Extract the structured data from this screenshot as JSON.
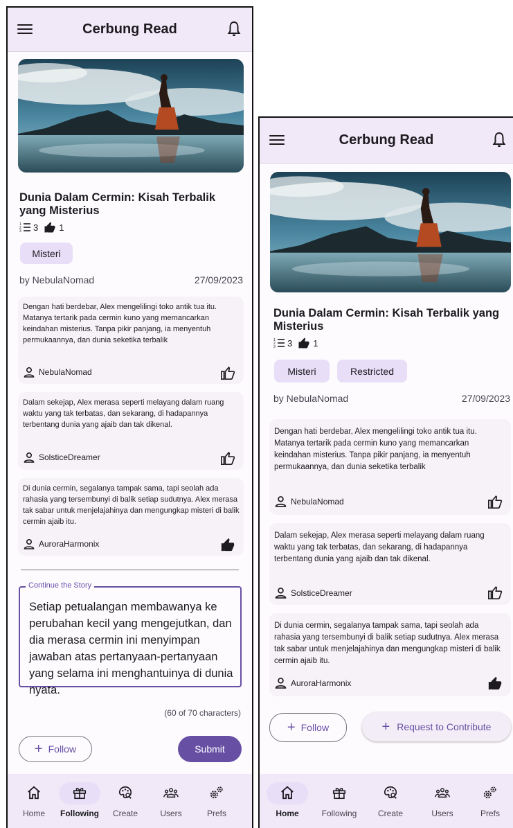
{
  "app": {
    "title": "Cerbung Read"
  },
  "story": {
    "title": "Dunia Dalam Cermin: Kisah Terbalik yang Misterius",
    "paragraphs_count": "3",
    "likes_count": "1",
    "author_line": "by NebulaNomad",
    "date": "27/09/2023"
  },
  "screen1": {
    "chips": [
      "Misteri"
    ]
  },
  "screen2": {
    "chips": [
      "Misteri",
      "Restricted"
    ]
  },
  "segments": [
    {
      "text": "Dengan hati berdebar, Alex mengelilingi toko antik tua itu. Matanya tertarik pada cermin kuno yang memancarkan keindahan misterius. Tanpa pikir panjang, ia menyentuh permukaannya, dan dunia seketika terbalik",
      "author": "NebulaNomad",
      "liked": false
    },
    {
      "text": "Dalam sekejap, Alex merasa seperti melayang dalam ruang waktu yang tak terbatas, dan sekarang, di hadapannya terbentang dunia yang ajaib dan tak dikenal.",
      "author": "SolsticeDreamer",
      "liked": false
    },
    {
      "text": "Di dunia cermin, segalanya tampak sama, tapi seolah ada rahasia yang tersembunyi di balik setiap sudutnya. Alex merasa tak sabar untuk menjelajahinya dan mengungkap misteri di balik cermin ajaib itu.",
      "author": "AuroraHarmonix",
      "liked": true
    }
  ],
  "continue": {
    "legend": "Continue the Story",
    "value": "Setiap petualangan membawanya ke perubahan kecil yang mengejutkan, dan dia merasa cermin ini menyimpan jawaban atas pertanyaan-pertanyaan yang selama ini menghantuinya di dunia nyata.",
    "counter": "(60 of 70 characters)"
  },
  "buttons": {
    "follow": "Follow",
    "submit": "Submit",
    "request": "Request to Contribute"
  },
  "nav": {
    "items": [
      {
        "label": "Home",
        "icon": "home-icon"
      },
      {
        "label": "Following",
        "icon": "gift-icon"
      },
      {
        "label": "Create",
        "icon": "create-palette-icon"
      },
      {
        "label": "Users",
        "icon": "users-icon"
      },
      {
        "label": "Prefs",
        "icon": "settings-icon"
      }
    ],
    "active_screen1": "Following",
    "active_screen2": "Home"
  },
  "colors": {
    "primary": "#6750a4",
    "chip": "#e8def8",
    "bar": "#f1e9f8"
  }
}
